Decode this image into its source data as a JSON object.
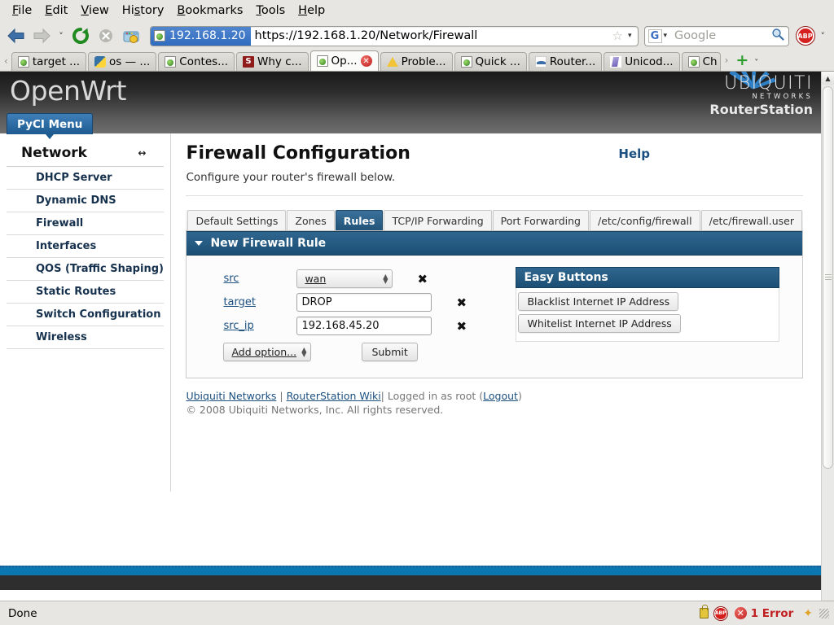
{
  "browser": {
    "menu": [
      {
        "label": "File",
        "accel": "F"
      },
      {
        "label": "Edit",
        "accel": "E"
      },
      {
        "label": "View",
        "accel": "V"
      },
      {
        "label": "History",
        "accel": "s"
      },
      {
        "label": "Bookmarks",
        "accel": "B"
      },
      {
        "label": "Tools",
        "accel": "T"
      },
      {
        "label": "Help",
        "accel": "H"
      }
    ],
    "toolbar": {
      "back_icon": "back-arrow-icon",
      "forward_icon": "forward-arrow-icon",
      "history_caret": "˅",
      "reload_icon": "reload-icon",
      "stop_icon": "stop-icon",
      "home_icon": "home-icon",
      "site_identity": "192.168.1.20",
      "url": "https://192.168.1.20/Network/Firewall",
      "bookmark_star": "☆",
      "url_caret": "▾",
      "search_engine": "G",
      "search_caret": "▾",
      "search_placeholder": "Google",
      "search_icon": "magnifier-icon",
      "abp_label": "ABP",
      "abp_caret": "˅"
    },
    "tabs": [
      {
        "label": "target ...",
        "favicon": "page-icon",
        "active": false,
        "close": false
      },
      {
        "label": "os — ...",
        "favicon": "python-icon",
        "active": false,
        "close": false
      },
      {
        "label": "Contes...",
        "favicon": "page-icon",
        "active": false,
        "close": false
      },
      {
        "label": "Why c...",
        "favicon": "stackoverflow-icon",
        "active": false,
        "close": false
      },
      {
        "label": "Op...",
        "favicon": "page-icon",
        "active": true,
        "close": true
      },
      {
        "label": "Proble...",
        "favicon": "warning-icon",
        "active": false,
        "close": false
      },
      {
        "label": "Quick ...",
        "favicon": "page-icon",
        "active": false,
        "close": false
      },
      {
        "label": "Router...",
        "favicon": "router-icon",
        "active": false,
        "close": false
      },
      {
        "label": "Unicod...",
        "favicon": "unicode-icon",
        "active": false,
        "close": false
      },
      {
        "label": "Ch",
        "favicon": "page-icon",
        "active": false,
        "close": false
      }
    ],
    "tab_scroll_left": "‹",
    "tab_scroll_right": "›",
    "new_tab": "+",
    "tab_list_caret": "˅"
  },
  "page": {
    "brand": "OpenWrt",
    "vendor": {
      "name": "UBIQUITI",
      "sub": "NETWORKS",
      "product": "RouterStation"
    },
    "pycl_menu": "PyCI Menu",
    "sidebar": {
      "title": "Network",
      "collapse_icon": "↔",
      "items": [
        {
          "label": "DHCP Server"
        },
        {
          "label": "Dynamic DNS"
        },
        {
          "label": "Firewall"
        },
        {
          "label": "Interfaces"
        },
        {
          "label": "QOS (Traffic Shaping)"
        },
        {
          "label": "Static Routes"
        },
        {
          "label": "Switch Configuration"
        },
        {
          "label": "Wireless"
        }
      ]
    },
    "help_label": "Help",
    "title": "Firewall Configuration",
    "description": "Configure your router's firewall below.",
    "tabs": [
      {
        "label": "Default Settings",
        "active": false
      },
      {
        "label": "Zones",
        "active": false
      },
      {
        "label": "Rules",
        "active": true
      },
      {
        "label": "TCP/IP Forwarding",
        "active": false
      },
      {
        "label": "Port Forwarding",
        "active": false
      },
      {
        "label": "/etc/config/firewall",
        "active": false
      },
      {
        "label": "/etc/firewall.user",
        "active": false
      }
    ],
    "panel": {
      "title": "New Firewall Rule",
      "collapse_icon": "triangle-down-icon",
      "rows": [
        {
          "label": "src",
          "type": "select",
          "value": "wan",
          "delete_icon": "✖"
        },
        {
          "label": "target",
          "type": "text",
          "value": "DROP",
          "delete_icon": "✖"
        },
        {
          "label": "src_ip",
          "type": "text",
          "value": "192.168.45.20",
          "delete_icon": "✖"
        }
      ],
      "add_option_label": "Add option...",
      "submit_label": "Submit"
    },
    "easy_buttons": {
      "title": "Easy Buttons",
      "buttons": [
        {
          "label": "Blacklist Internet IP Address"
        },
        {
          "label": "Whitelist Internet IP Address"
        }
      ]
    },
    "footer": {
      "link1": "Ubiquiti Networks",
      "sep": " | ",
      "link2": "RouterStation Wiki",
      "mid": "| Logged in as root (",
      "logout": "Logout",
      "close": ")",
      "copyright": "© 2008 Ubiquiti Networks, Inc. All rights reserved."
    }
  },
  "statusbar": {
    "status": "Done",
    "lock_icon": "lock-icon",
    "abp_icon": "abp-icon",
    "error_icon": "error-icon",
    "error_text": "1 Error",
    "star_icon": "star-icon",
    "resizer_icon": "resize-grip-icon"
  },
  "colors": {
    "accent_blue": "#1c4f74",
    "link_blue": "#1a4f80",
    "error_red": "#c02020",
    "footer_strip": "#0b76b0"
  }
}
